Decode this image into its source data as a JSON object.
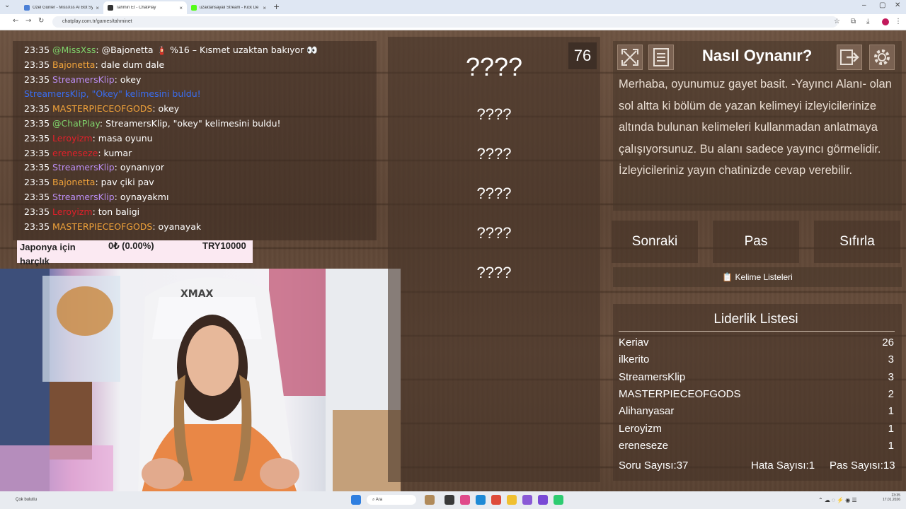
{
  "browser": {
    "tabs": [
      {
        "title": "Özel Günler - MissXss AI Bot Sy",
        "favicon_color": "#4a7fd6"
      },
      {
        "title": "Tahmin Et - ChatPlay",
        "favicon_color": "#333333"
      },
      {
        "title": "uzaktansayali Stream - Kick De",
        "favicon_color": "#53fc18"
      }
    ],
    "url": "chatplay.com.tr/games/tahminet"
  },
  "chat": {
    "messages": [
      {
        "time": "23:35",
        "user": "@MissXss",
        "user_color": "#7fd36b",
        "text": ": @Bajonetta 🧯 %16 – Kısmet uzaktan bakıyor 👀"
      },
      {
        "time": "23:35",
        "user": "Bajonetta",
        "user_color": "#f0a23a",
        "text": ": dale dum dale"
      },
      {
        "time": "23:35",
        "user": "StreamersKlip",
        "user_color": "#b98cf0",
        "text": ": okey"
      },
      {
        "time": "",
        "user": "StreamersKlip, \"Okey\" kelimesini buldu!",
        "user_color": "#3a6df0",
        "text": ""
      },
      {
        "time": "23:35",
        "user": "MASTERPIECEOFGODS",
        "user_color": "#f0a23a",
        "text": ": okey"
      },
      {
        "time": "23:35",
        "user": "@ChatPlay",
        "user_color": "#7fd36b",
        "text": ": StreamersKlip, \"okey\" kelimesini buldu!"
      },
      {
        "time": "23:35",
        "user": "Leroyizm",
        "user_color": "#e0202a",
        "text": ": masa oyunu"
      },
      {
        "time": "23:35",
        "user": "ereneseze",
        "user_color": "#e0202a",
        "text": ": kumar"
      },
      {
        "time": "23:35",
        "user": "StreamersKlip",
        "user_color": "#b98cf0",
        "text": ": oynanıyor"
      },
      {
        "time": "23:35",
        "user": "Bajonetta",
        "user_color": "#f0a23a",
        "text": ": pav çiki pav"
      },
      {
        "time": "23:35",
        "user": "StreamersKlip",
        "user_color": "#b98cf0",
        "text": ": oynayakmı"
      },
      {
        "time": "23:35",
        "user": "Leroyizm",
        "user_color": "#e0202a",
        "text": ": ton baligi"
      },
      {
        "time": "23:35",
        "user": "MASTERPIECEOFGODS",
        "user_color": "#f0a23a",
        "text": ": oyanayak"
      }
    ]
  },
  "donation": {
    "label": "Japonya için harçlık",
    "current": "0₺ (0.00%)",
    "goal": "TRY10000"
  },
  "game": {
    "timer": "76",
    "hidden_words": [
      "????",
      "????",
      "????",
      "????",
      "????",
      "????"
    ]
  },
  "howto": {
    "title": "Nasıl Oynanır?",
    "text": "Merhaba, oyunumuz gayet basit. -Yayıncı Alanı- olan sol altta ki bölüm de yazan kelimeyi izleyicilerinize altında bulunan kelimeleri kullanmadan anlatmaya çalışıyorsunuz. Bu alanı sadece yayıncı görmelidir. İzleyicileriniz yayın chatinizde cevap verebilir."
  },
  "buttons": {
    "next": "Sonraki",
    "pass": "Pas",
    "reset": "Sıfırla"
  },
  "word_lists": {
    "label": "Kelime Listeleri"
  },
  "leaderboard": {
    "title": "Liderlik Listesi",
    "rows": [
      {
        "name": "Keriav",
        "score": "26"
      },
      {
        "name": "ilkerito",
        "score": "3"
      },
      {
        "name": "StreamersKlip",
        "score": "3"
      },
      {
        "name": "MASTERPIECEOFGODS",
        "score": "2"
      },
      {
        "name": "Alihanyasar",
        "score": "1"
      },
      {
        "name": "Leroyizm",
        "score": "1"
      },
      {
        "name": "ereneseze",
        "score": "1"
      }
    ]
  },
  "stats": {
    "questions": "Soru Sayısı:37",
    "errors": "Hata Sayısı:1",
    "passes": "Pas Sayısı:13"
  },
  "taskbar": {
    "weather": "Çok bulutlu",
    "search": "Ara",
    "time": "23:35",
    "date": "17.01.2026"
  }
}
